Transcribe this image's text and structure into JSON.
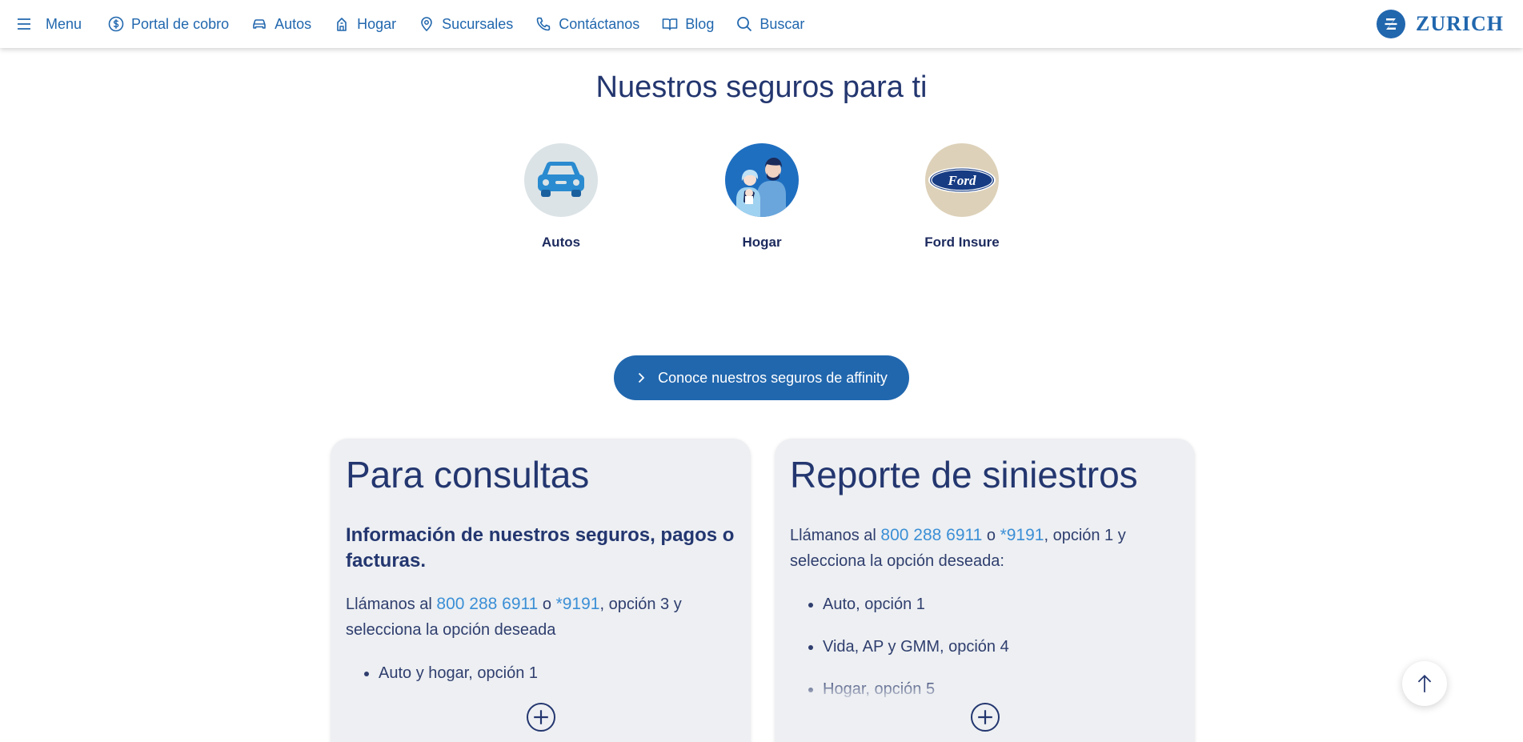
{
  "colors": {
    "brand_blue": "#2167ae",
    "navy_text": "#23366f",
    "link_blue": "#3b8fd6",
    "card_bg": "#edeff2"
  },
  "nav": {
    "menu": {
      "label": "Menu",
      "icon": "hamburger-icon"
    },
    "items": [
      {
        "label": "Portal de cobro",
        "icon": "dollar-circle-icon"
      },
      {
        "label": "Autos",
        "icon": "car-icon"
      },
      {
        "label": "Hogar",
        "icon": "house-icon"
      },
      {
        "label": "Sucursales",
        "icon": "location-pin-icon"
      },
      {
        "label": "Contáctanos",
        "icon": "phone-icon"
      },
      {
        "label": "Blog",
        "icon": "book-icon"
      },
      {
        "label": "Buscar",
        "icon": "search-icon"
      }
    ],
    "logo_text": "ZURICH"
  },
  "products_section": {
    "title": "Nuestros seguros para ti",
    "products": [
      {
        "label": "Autos",
        "icon": "car-illustration-icon"
      },
      {
        "label": "Hogar",
        "icon": "family-illustration-icon"
      },
      {
        "label": "Ford Insure",
        "icon": "ford-logo-icon"
      }
    ],
    "affinity_button": "Conoce nuestros seguros de affinity"
  },
  "consultas": {
    "title": "Para consultas",
    "subtitle": "Información de nuestros seguros, pagos o facturas.",
    "text_before": "Llámanos al ",
    "phone1": "800 288 6911",
    "text_or": " o ",
    "phone2": "*9191",
    "text_after": ", opción 3 y selecciona la opción deseada",
    "items": [
      "Auto y hogar, opción 1"
    ]
  },
  "siniestros": {
    "title": "Reporte de siniestros",
    "text_before": "Llámanos al ",
    "phone1": "800 288 6911",
    "text_or": " o ",
    "phone2": "*9191",
    "text_after": ", opción 1 y selecciona la opción deseada:",
    "items": [
      "Auto, opción 1",
      "Vida, AP y GMM, opción 4",
      "Hogar, opción 5"
    ]
  }
}
